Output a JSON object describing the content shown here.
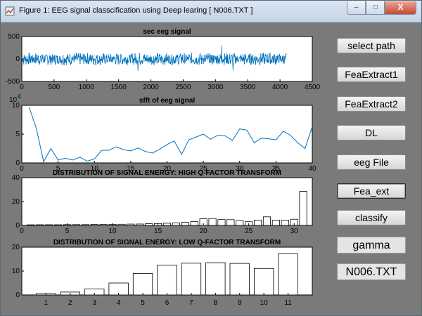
{
  "window": {
    "title": "Figure 1: EEG signal classcification using Deep learing  [ N006.TXT ]",
    "min_glyph": "–",
    "max_glyph": "□",
    "close_glyph": "X"
  },
  "buttons": [
    "select path",
    "FeaExtract1",
    "FeaExtract2",
    "DL",
    "eeg File",
    "Fea_ext",
    "classify"
  ],
  "labels": {
    "gamma": "gamma",
    "file": "N006.TXT"
  },
  "colors": {
    "line": "#0072bd",
    "bar_edge": "#000000",
    "figure_bg": "#7a7a7a",
    "axes_bg": "#ffffff"
  },
  "chart_data": [
    {
      "type": "line",
      "title": "sec eeg signal",
      "xlim": [
        0,
        4500
      ],
      "ylim": [
        -500,
        500
      ],
      "xticks": [
        0,
        500,
        1000,
        1500,
        2000,
        2500,
        3000,
        3500,
        4000,
        4500
      ],
      "yticks": [
        -500,
        0,
        500
      ],
      "series": [
        {
          "x_range": [
            0,
            4097
          ],
          "amplitude": 120,
          "min": -260,
          "max": 300
        }
      ]
    },
    {
      "type": "line",
      "title": "sfft of eeg signal",
      "xlim": [
        0,
        40
      ],
      "ylim": [
        0,
        100000
      ],
      "yscale_label": "10^4",
      "xticks": [
        0,
        5,
        10,
        15,
        20,
        25,
        30,
        35,
        40
      ],
      "yticks": [
        0,
        5,
        10
      ],
      "x": [
        1,
        2,
        3,
        4,
        5,
        6,
        7,
        8,
        9,
        10,
        11,
        12,
        13,
        14,
        15,
        16,
        17,
        18,
        19,
        20,
        21,
        22,
        23,
        24,
        25,
        26,
        27,
        28,
        29,
        30,
        31,
        32,
        33,
        34,
        35,
        36,
        37,
        38,
        39,
        40
      ],
      "values": [
        97000,
        60000,
        2000,
        25000,
        5000,
        8000,
        5000,
        10000,
        3000,
        7000,
        22000,
        22000,
        28000,
        23000,
        21000,
        26000,
        20000,
        17000,
        24000,
        32000,
        38000,
        15000,
        40000,
        45000,
        50000,
        41000,
        48000,
        47000,
        39000,
        59000,
        57000,
        35000,
        43000,
        42000,
        40000,
        55000,
        48000,
        35000,
        25000,
        63000
      ]
    },
    {
      "type": "bar",
      "title": "DISTRIBUTION OF SIGNAL ENERGY: HIGH Q-FACTOR TRANSFORM",
      "xlim": [
        0,
        32
      ],
      "ylim": [
        0,
        40
      ],
      "xticks": [
        0,
        5,
        10,
        15,
        20,
        25,
        30
      ],
      "yticks": [
        0,
        20,
        40
      ],
      "x": [
        1,
        2,
        3,
        4,
        5,
        6,
        7,
        8,
        9,
        10,
        11,
        12,
        13,
        14,
        15,
        16,
        17,
        18,
        19,
        20,
        21,
        22,
        23,
        24,
        25,
        26,
        27,
        28,
        29,
        30,
        31
      ],
      "values": [
        0.5,
        0.6,
        0.6,
        0.6,
        0.7,
        0.7,
        0.7,
        0.8,
        0.8,
        0.9,
        1.0,
        1.1,
        1.2,
        1.4,
        1.6,
        1.8,
        2.2,
        2.6,
        3.3,
        5.5,
        5.8,
        4.9,
        4.8,
        4.2,
        3.1,
        4.5,
        7.2,
        4.5,
        4.4,
        5.2,
        28.5
      ]
    },
    {
      "type": "bar",
      "title": "DISTRIBUTION OF SIGNAL ENERGY: LOW Q-FACTOR TRANSFORM",
      "ylim": [
        0,
        20
      ],
      "yticks": [
        0,
        10,
        20
      ],
      "categories": [
        "1",
        "2",
        "3",
        "4",
        "5",
        "6",
        "7",
        "8",
        "9",
        "10",
        "11"
      ],
      "values": [
        0.6,
        1.2,
        2.5,
        5.0,
        9.0,
        12.5,
        13.3,
        13.5,
        13.2,
        11.1,
        17.3
      ]
    }
  ]
}
